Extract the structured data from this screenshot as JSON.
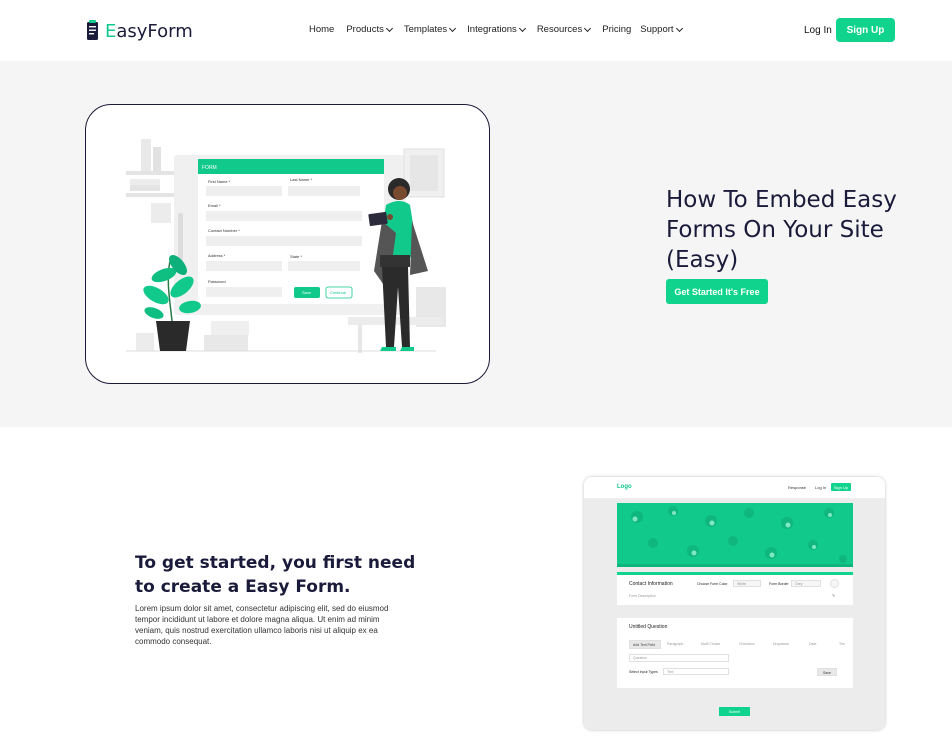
{
  "brand": {
    "name_prefix": "E",
    "name_rest": "asyForm"
  },
  "nav": {
    "items": [
      {
        "label": "Home",
        "dropdown": false
      },
      {
        "label": "Products",
        "dropdown": true
      },
      {
        "label": "Templates",
        "dropdown": true
      },
      {
        "label": "Integrations",
        "dropdown": true
      },
      {
        "label": "Resources",
        "dropdown": true
      },
      {
        "label": "Pricing",
        "dropdown": false
      },
      {
        "label": "Support",
        "dropdown": true
      }
    ],
    "login": "Log In",
    "signup": "Sign Up"
  },
  "hero": {
    "title": "How To Embed Easy Forms On Your Site (Easy)",
    "cta": "Get Started It's Free",
    "illustration": {
      "form_header": "FORM",
      "labels": [
        "First Name *",
        "Last Name *",
        "Email *",
        "Contact Number *",
        "Address *",
        "State *",
        "Password"
      ],
      "save_btn": "Save",
      "continue_btn": "Continue"
    }
  },
  "section2": {
    "title": "To get started, you first need to create a Easy Form.",
    "body": "Lorem ipsum dolor sit amet, consectetur adipiscing elit, sed do eiusmod tempor incididunt ut labore et dolore magna aliqua. Ut enim ad minim veniam, quis nostrud exercitation ullamco laboris nisi ut aliquip ex ea commodo consequat."
  },
  "mockup": {
    "logo": "Logo",
    "responses": "Response",
    "login": "Log In",
    "signup": "Sign Up",
    "contact_title": "Contact Information",
    "choose_color": "Choose Form Color",
    "color_value": "White",
    "form_border": "Form Border",
    "border_value": "Grey",
    "form_description": "Form Description",
    "untitled_question": "Untitled Question",
    "tabs": [
      "Add Text Field",
      "Paragraph",
      "Multi Choice",
      "Checkbox",
      "Dropdown",
      "Date",
      "Tim"
    ],
    "question_placeholder": "Question",
    "select_input": "Select Input Types",
    "select_value": "Text",
    "save": "Save",
    "submit": "Submit"
  },
  "colors": {
    "accent": "#10d48e",
    "navy": "#1a1a3a",
    "hero_bg": "#f5f5f5"
  }
}
